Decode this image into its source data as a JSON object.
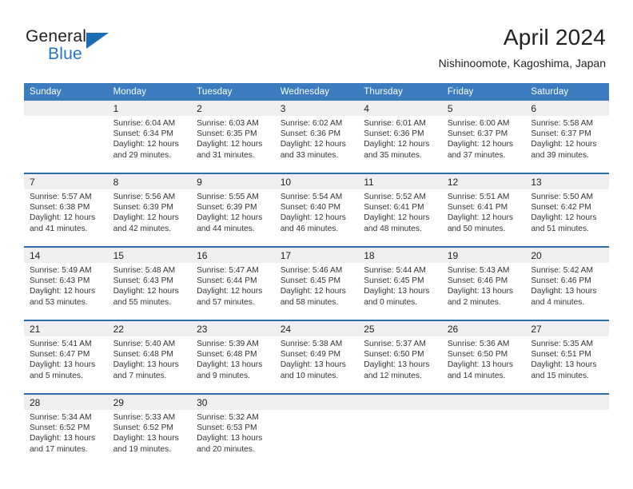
{
  "brand": {
    "word_general": "General",
    "word_blue": "Blue"
  },
  "header": {
    "title": "April 2024",
    "subtitle": "Nishinoomote, Kagoshima, Japan"
  },
  "calendar": {
    "weekday_headers": [
      "Sunday",
      "Monday",
      "Tuesday",
      "Wednesday",
      "Thursday",
      "Friday",
      "Saturday"
    ],
    "accent_header_color": "#3a7cbe",
    "accent_rule_color": "#2d6da4",
    "daynum_bg_color": "#efefef",
    "weeks": [
      {
        "days": [
          {
            "num": "",
            "sunrise": "",
            "sunset": "",
            "daylight": ""
          },
          {
            "num": "1",
            "sunrise": "Sunrise: 6:04 AM",
            "sunset": "Sunset: 6:34 PM",
            "daylight": "Daylight: 12 hours and 29 minutes."
          },
          {
            "num": "2",
            "sunrise": "Sunrise: 6:03 AM",
            "sunset": "Sunset: 6:35 PM",
            "daylight": "Daylight: 12 hours and 31 minutes."
          },
          {
            "num": "3",
            "sunrise": "Sunrise: 6:02 AM",
            "sunset": "Sunset: 6:36 PM",
            "daylight": "Daylight: 12 hours and 33 minutes."
          },
          {
            "num": "4",
            "sunrise": "Sunrise: 6:01 AM",
            "sunset": "Sunset: 6:36 PM",
            "daylight": "Daylight: 12 hours and 35 minutes."
          },
          {
            "num": "5",
            "sunrise": "Sunrise: 6:00 AM",
            "sunset": "Sunset: 6:37 PM",
            "daylight": "Daylight: 12 hours and 37 minutes."
          },
          {
            "num": "6",
            "sunrise": "Sunrise: 5:58 AM",
            "sunset": "Sunset: 6:37 PM",
            "daylight": "Daylight: 12 hours and 39 minutes."
          }
        ]
      },
      {
        "days": [
          {
            "num": "7",
            "sunrise": "Sunrise: 5:57 AM",
            "sunset": "Sunset: 6:38 PM",
            "daylight": "Daylight: 12 hours and 41 minutes."
          },
          {
            "num": "8",
            "sunrise": "Sunrise: 5:56 AM",
            "sunset": "Sunset: 6:39 PM",
            "daylight": "Daylight: 12 hours and 42 minutes."
          },
          {
            "num": "9",
            "sunrise": "Sunrise: 5:55 AM",
            "sunset": "Sunset: 6:39 PM",
            "daylight": "Daylight: 12 hours and 44 minutes."
          },
          {
            "num": "10",
            "sunrise": "Sunrise: 5:54 AM",
            "sunset": "Sunset: 6:40 PM",
            "daylight": "Daylight: 12 hours and 46 minutes."
          },
          {
            "num": "11",
            "sunrise": "Sunrise: 5:52 AM",
            "sunset": "Sunset: 6:41 PM",
            "daylight": "Daylight: 12 hours and 48 minutes."
          },
          {
            "num": "12",
            "sunrise": "Sunrise: 5:51 AM",
            "sunset": "Sunset: 6:41 PM",
            "daylight": "Daylight: 12 hours and 50 minutes."
          },
          {
            "num": "13",
            "sunrise": "Sunrise: 5:50 AM",
            "sunset": "Sunset: 6:42 PM",
            "daylight": "Daylight: 12 hours and 51 minutes."
          }
        ]
      },
      {
        "days": [
          {
            "num": "14",
            "sunrise": "Sunrise: 5:49 AM",
            "sunset": "Sunset: 6:43 PM",
            "daylight": "Daylight: 12 hours and 53 minutes."
          },
          {
            "num": "15",
            "sunrise": "Sunrise: 5:48 AM",
            "sunset": "Sunset: 6:43 PM",
            "daylight": "Daylight: 12 hours and 55 minutes."
          },
          {
            "num": "16",
            "sunrise": "Sunrise: 5:47 AM",
            "sunset": "Sunset: 6:44 PM",
            "daylight": "Daylight: 12 hours and 57 minutes."
          },
          {
            "num": "17",
            "sunrise": "Sunrise: 5:46 AM",
            "sunset": "Sunset: 6:45 PM",
            "daylight": "Daylight: 12 hours and 58 minutes."
          },
          {
            "num": "18",
            "sunrise": "Sunrise: 5:44 AM",
            "sunset": "Sunset: 6:45 PM",
            "daylight": "Daylight: 13 hours and 0 minutes."
          },
          {
            "num": "19",
            "sunrise": "Sunrise: 5:43 AM",
            "sunset": "Sunset: 6:46 PM",
            "daylight": "Daylight: 13 hours and 2 minutes."
          },
          {
            "num": "20",
            "sunrise": "Sunrise: 5:42 AM",
            "sunset": "Sunset: 6:46 PM",
            "daylight": "Daylight: 13 hours and 4 minutes."
          }
        ]
      },
      {
        "days": [
          {
            "num": "21",
            "sunrise": "Sunrise: 5:41 AM",
            "sunset": "Sunset: 6:47 PM",
            "daylight": "Daylight: 13 hours and 5 minutes."
          },
          {
            "num": "22",
            "sunrise": "Sunrise: 5:40 AM",
            "sunset": "Sunset: 6:48 PM",
            "daylight": "Daylight: 13 hours and 7 minutes."
          },
          {
            "num": "23",
            "sunrise": "Sunrise: 5:39 AM",
            "sunset": "Sunset: 6:48 PM",
            "daylight": "Daylight: 13 hours and 9 minutes."
          },
          {
            "num": "24",
            "sunrise": "Sunrise: 5:38 AM",
            "sunset": "Sunset: 6:49 PM",
            "daylight": "Daylight: 13 hours and 10 minutes."
          },
          {
            "num": "25",
            "sunrise": "Sunrise: 5:37 AM",
            "sunset": "Sunset: 6:50 PM",
            "daylight": "Daylight: 13 hours and 12 minutes."
          },
          {
            "num": "26",
            "sunrise": "Sunrise: 5:36 AM",
            "sunset": "Sunset: 6:50 PM",
            "daylight": "Daylight: 13 hours and 14 minutes."
          },
          {
            "num": "27",
            "sunrise": "Sunrise: 5:35 AM",
            "sunset": "Sunset: 6:51 PM",
            "daylight": "Daylight: 13 hours and 15 minutes."
          }
        ]
      },
      {
        "days": [
          {
            "num": "28",
            "sunrise": "Sunrise: 5:34 AM",
            "sunset": "Sunset: 6:52 PM",
            "daylight": "Daylight: 13 hours and 17 minutes."
          },
          {
            "num": "29",
            "sunrise": "Sunrise: 5:33 AM",
            "sunset": "Sunset: 6:52 PM",
            "daylight": "Daylight: 13 hours and 19 minutes."
          },
          {
            "num": "30",
            "sunrise": "Sunrise: 5:32 AM",
            "sunset": "Sunset: 6:53 PM",
            "daylight": "Daylight: 13 hours and 20 minutes."
          },
          {
            "num": "",
            "sunrise": "",
            "sunset": "",
            "daylight": ""
          },
          {
            "num": "",
            "sunrise": "",
            "sunset": "",
            "daylight": ""
          },
          {
            "num": "",
            "sunrise": "",
            "sunset": "",
            "daylight": ""
          },
          {
            "num": "",
            "sunrise": "",
            "sunset": "",
            "daylight": ""
          }
        ]
      }
    ]
  }
}
